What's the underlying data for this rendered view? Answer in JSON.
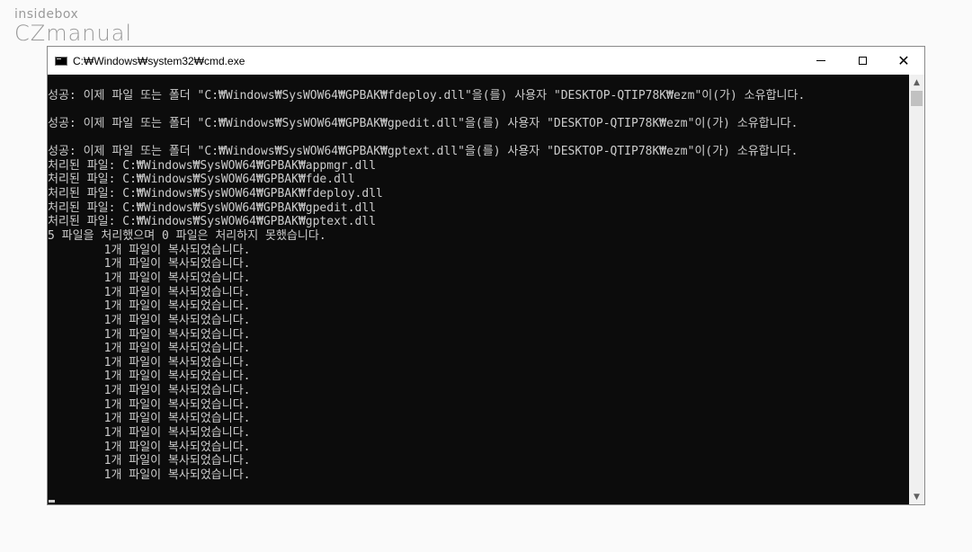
{
  "watermark": {
    "line1": "insidebox",
    "line2": "CZmanual"
  },
  "window": {
    "title": "C:₩Windows₩system32₩cmd.exe",
    "icon": "cmd-icon"
  },
  "controls": {
    "minimize_icon": "minimize-icon",
    "maximize_icon": "maximize-icon",
    "close_icon": "close-icon",
    "close_glyph": "✕"
  },
  "scrollbar": {
    "up_glyph": "▲",
    "down_glyph": "▼"
  },
  "console": {
    "lines": [
      "",
      "성공: 이제 파일 또는 폴더 \"C:₩Windows₩SysWOW64₩GPBAK₩fdeploy.dll\"을(를) 사용자 \"DESKTOP-QTIP78K₩ezm\"이(가) 소유합니다.",
      "",
      "성공: 이제 파일 또는 폴더 \"C:₩Windows₩SysWOW64₩GPBAK₩gpedit.dll\"을(를) 사용자 \"DESKTOP-QTIP78K₩ezm\"이(가) 소유합니다.",
      "",
      "성공: 이제 파일 또는 폴더 \"C:₩Windows₩SysWOW64₩GPBAK₩gptext.dll\"을(를) 사용자 \"DESKTOP-QTIP78K₩ezm\"이(가) 소유합니다.",
      "처리된 파일: C:₩Windows₩SysWOW64₩GPBAK₩appmgr.dll",
      "처리된 파일: C:₩Windows₩SysWOW64₩GPBAK₩fde.dll",
      "처리된 파일: C:₩Windows₩SysWOW64₩GPBAK₩fdeploy.dll",
      "처리된 파일: C:₩Windows₩SysWOW64₩GPBAK₩gpedit.dll",
      "처리된 파일: C:₩Windows₩SysWOW64₩GPBAK₩gptext.dll",
      "5 파일을 처리했으며 0 파일은 처리하지 못했습니다.",
      "        1개 파일이 복사되었습니다.",
      "        1개 파일이 복사되었습니다.",
      "        1개 파일이 복사되었습니다.",
      "        1개 파일이 복사되었습니다.",
      "        1개 파일이 복사되었습니다.",
      "        1개 파일이 복사되었습니다.",
      "        1개 파일이 복사되었습니다.",
      "        1개 파일이 복사되었습니다.",
      "        1개 파일이 복사되었습니다.",
      "        1개 파일이 복사되었습니다.",
      "        1개 파일이 복사되었습니다.",
      "        1개 파일이 복사되었습니다.",
      "        1개 파일이 복사되었습니다.",
      "        1개 파일이 복사되었습니다.",
      "        1개 파일이 복사되었습니다.",
      "        1개 파일이 복사되었습니다.",
      "        1개 파일이 복사되었습니다."
    ]
  }
}
